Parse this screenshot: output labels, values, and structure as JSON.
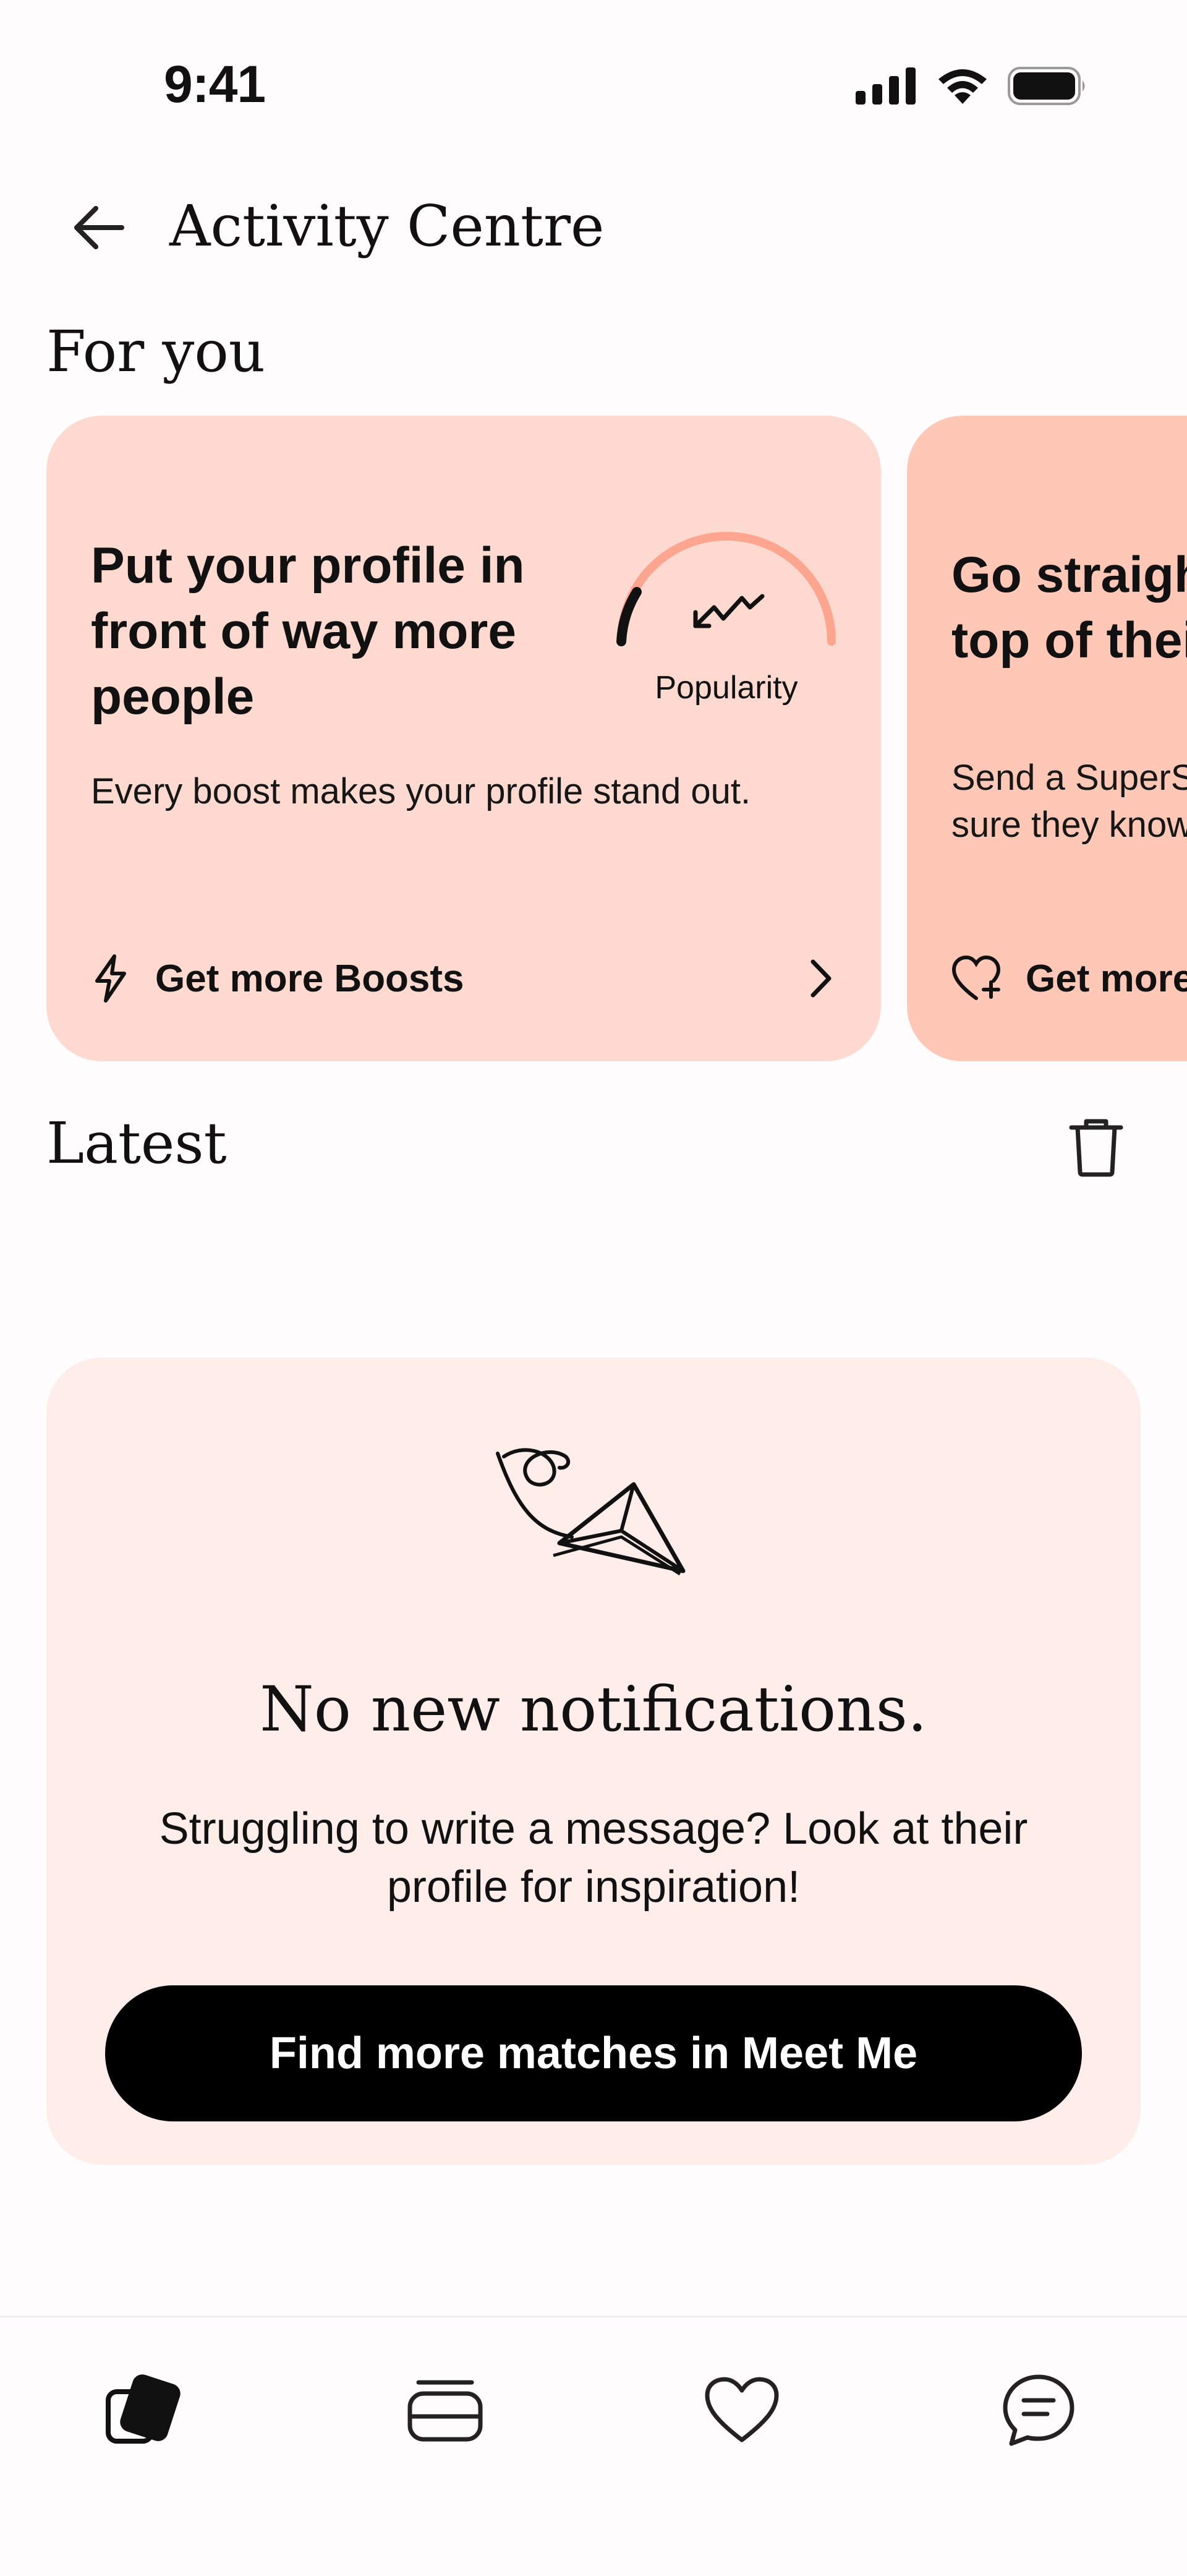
{
  "status_bar": {
    "time": "9:41",
    "icons": [
      "cellular-signal-icon",
      "wifi-icon",
      "battery-icon"
    ]
  },
  "header": {
    "back_icon": "arrow-left-icon",
    "title": "Activity Centre"
  },
  "sections": {
    "for_you": "For you",
    "latest": "Latest"
  },
  "cards": [
    {
      "headline": "Put your profile in front of way more people",
      "body": "Every boost makes your profile stand out.",
      "gauge_label": "Popularity",
      "cta_icon": "lightning-icon",
      "cta_label": "Get more Boosts",
      "background": "#fdd9d0"
    },
    {
      "headline_line1": "Go straight to the",
      "headline_line2": "top of their list",
      "body_line1": "Send a SuperSwipe to make",
      "body_line2": "sure they know you like them.",
      "cta_icon": "heart-plus-icon",
      "cta_label": "Get more SuperSwipes",
      "background": "#fec7b6"
    }
  ],
  "empty_state": {
    "illustration": "paper-plane-icon",
    "title": "No new notifications.",
    "body": "Struggling to write a message? Look at their profile for inspiration!",
    "button_label": "Find more matches in Meet Me",
    "background": "#ffedea"
  },
  "tab_bar": {
    "items": [
      "encounters-icon",
      "cards-stack-icon",
      "heart-icon",
      "chat-bubble-icon"
    ],
    "active": 0
  },
  "colors": {
    "accent": "#fda58e",
    "button": "#000000"
  }
}
